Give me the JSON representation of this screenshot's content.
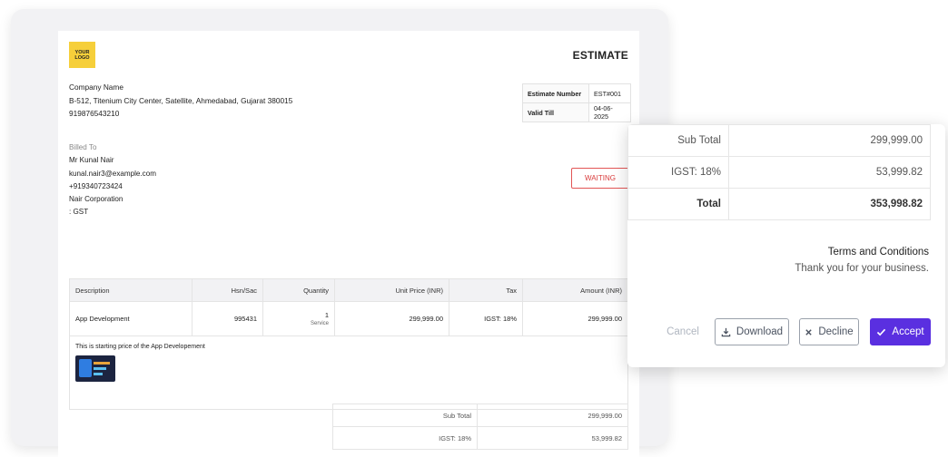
{
  "estimate": {
    "logo_line1": "YOUR",
    "logo_line2": "LOGO",
    "title": "ESTIMATE",
    "company": {
      "name": "Company Name",
      "address": "B-512, Titenium City Center, Satellite, Ahmedabad, Gujarat 380015",
      "phone": "919876543210"
    },
    "meta": [
      {
        "label": "Estimate Number",
        "value": "EST#001"
      },
      {
        "label": "Valid Till",
        "value": "04-06-2025"
      }
    ],
    "billed_to": {
      "label": "Billed To",
      "name": "Mr Kunal Nair",
      "email": "kunal.nair3@example.com",
      "phone": "+919340723424",
      "company": "Nair Corporation",
      "gst": ": GST"
    },
    "status": "WAITING",
    "columns": {
      "description": "Description",
      "hsn": "Hsn/Sac",
      "quantity": "Quantity",
      "unit_price": "Unit Price (INR)",
      "tax": "Tax",
      "amount": "Amount (INR)"
    },
    "item": {
      "description": "App Development",
      "hsn": "995431",
      "quantity": "1",
      "quantity_unit": "Service",
      "unit_price": "299,999.00",
      "tax": "IGST: 18%",
      "amount": "299,999.00",
      "note": "This is starting price of the App Developement"
    },
    "summary": [
      {
        "label": "Sub Total",
        "value": "299,999.00"
      },
      {
        "label": "IGST: 18%",
        "value": "53,999.82"
      }
    ]
  },
  "card": {
    "totals": [
      {
        "label": "Sub Total",
        "value": "299,999.00"
      },
      {
        "label": "IGST: 18%",
        "value": "53,999.82"
      },
      {
        "label": "Total",
        "value": "353,998.82"
      }
    ],
    "terms_heading": "Terms and Conditions",
    "terms_text": "Thank you for your business.",
    "cancel_label": "Cancel",
    "download_label": "Download",
    "decline_label": "Decline",
    "accept_label": "Accept",
    "accent_color": "#5a2fe0"
  }
}
